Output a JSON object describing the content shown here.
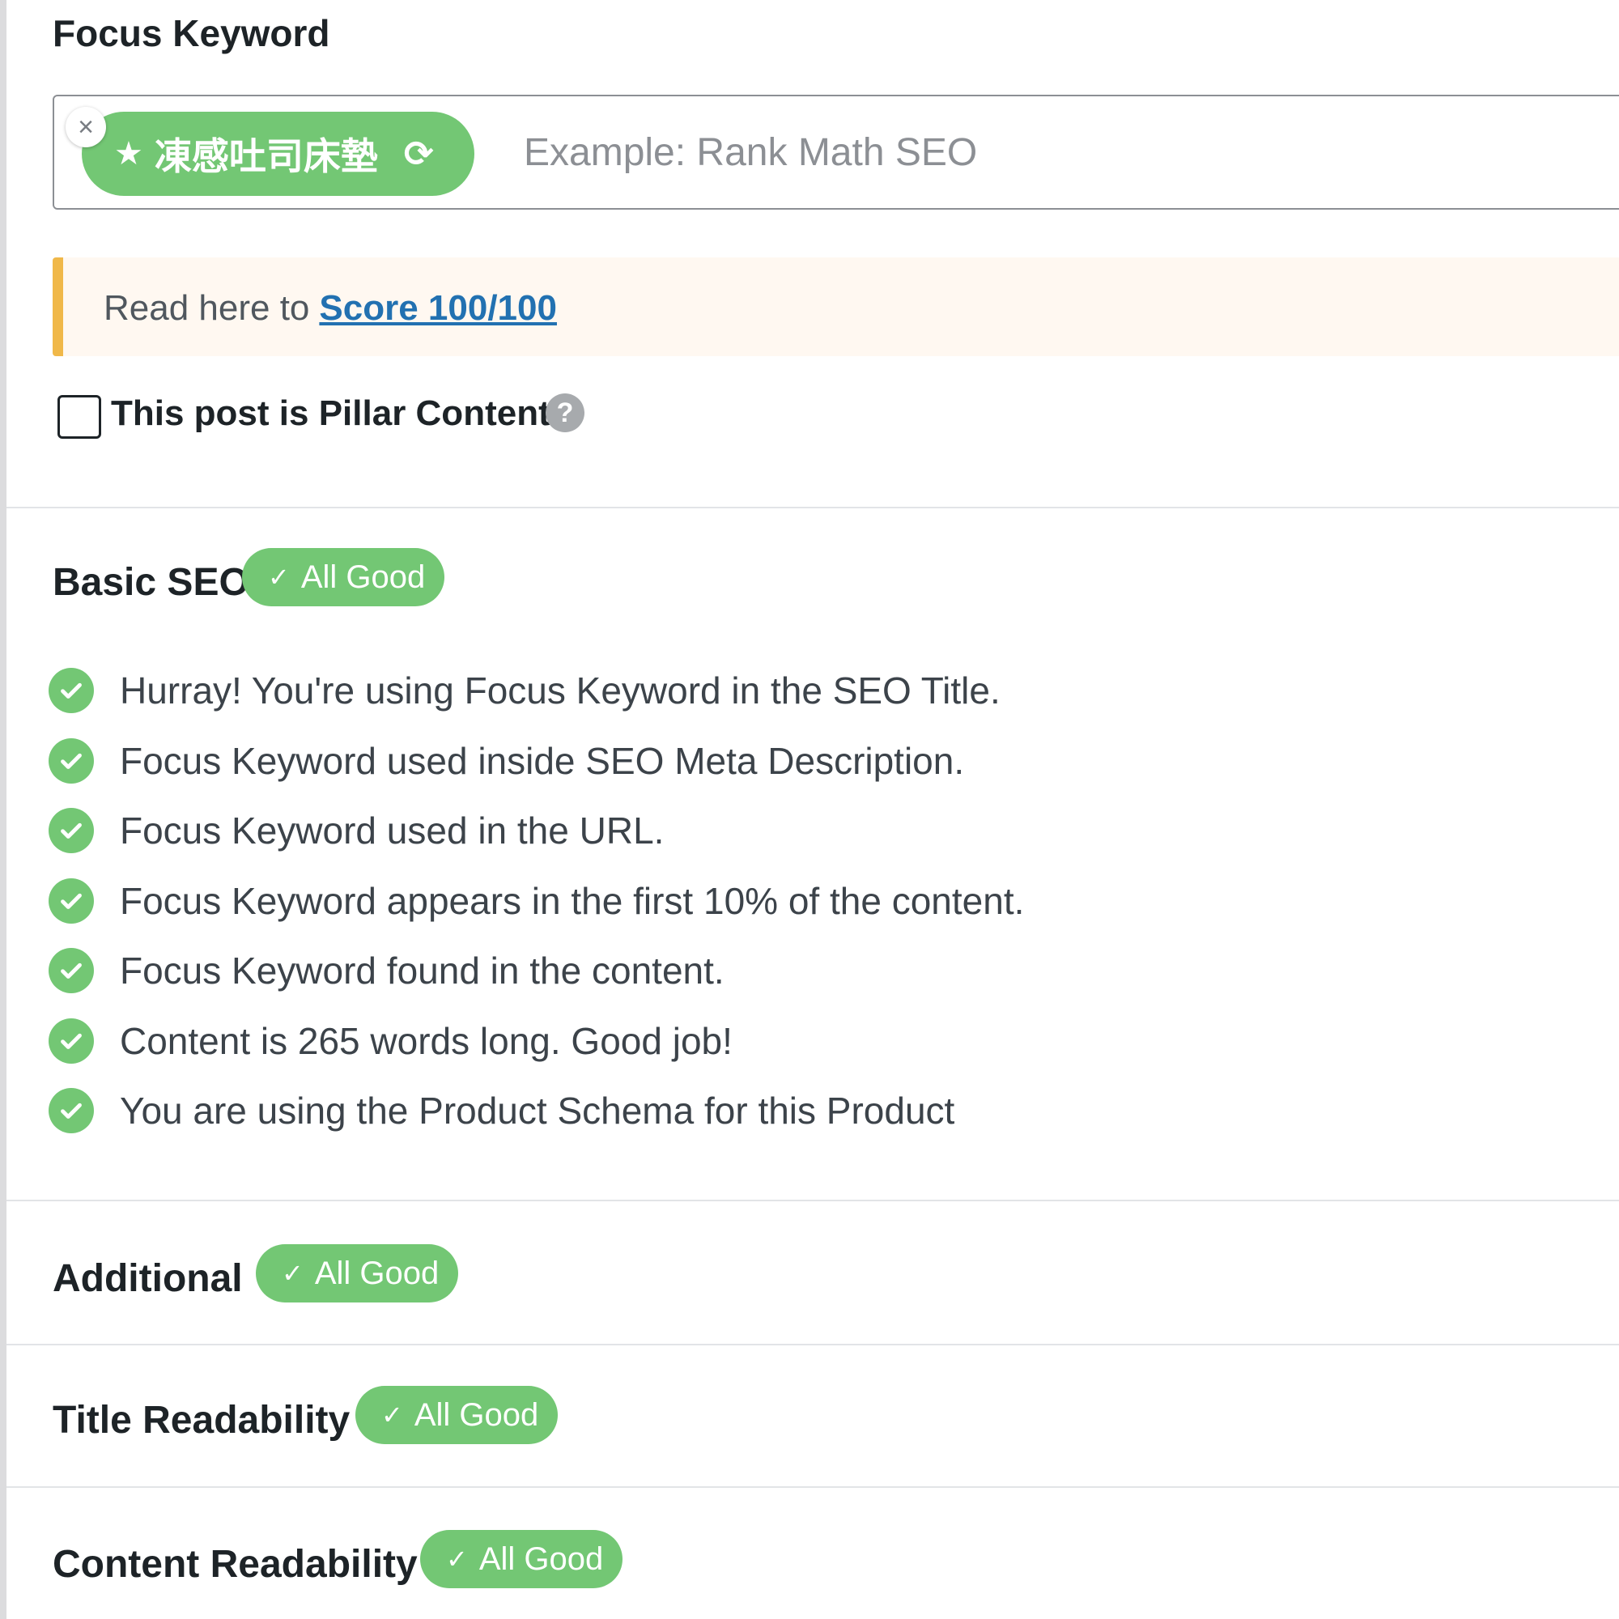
{
  "focus_keyword": {
    "title": "Focus Keyword",
    "tag": "凍感吐司床墊",
    "placeholder": "Example: Rank Math SEO",
    "remove_glyph": "×",
    "star_icon": "star-icon",
    "rotate_icon": "rotate-icon"
  },
  "notice": {
    "text": "Read here to",
    "link": "Score 100/100"
  },
  "pillar": {
    "label": "This post is Pillar Content",
    "help": "?"
  },
  "sections": {
    "basic_seo": {
      "title": "Basic SEO",
      "badge": "All Good",
      "items": [
        "Hurray! You're using Focus Keyword in the SEO Title.",
        "Focus Keyword used inside SEO Meta Description.",
        "Focus Keyword used in the URL.",
        "Focus Keyword appears in the first 10% of the content.",
        "Focus Keyword found in the content.",
        "Content is 265 words long. Good job!",
        "You are using the Product Schema for this Product"
      ]
    },
    "additional": {
      "title": "Additional",
      "badge": "All Good"
    },
    "title_readability": {
      "title": "Title Readability",
      "badge": "All Good"
    },
    "content_readability": {
      "title": "Content Readability",
      "badge": "All Good"
    }
  },
  "colors": {
    "good_green": "#73c774",
    "notice_bar": "#f0b849",
    "link": "#2271b1"
  }
}
